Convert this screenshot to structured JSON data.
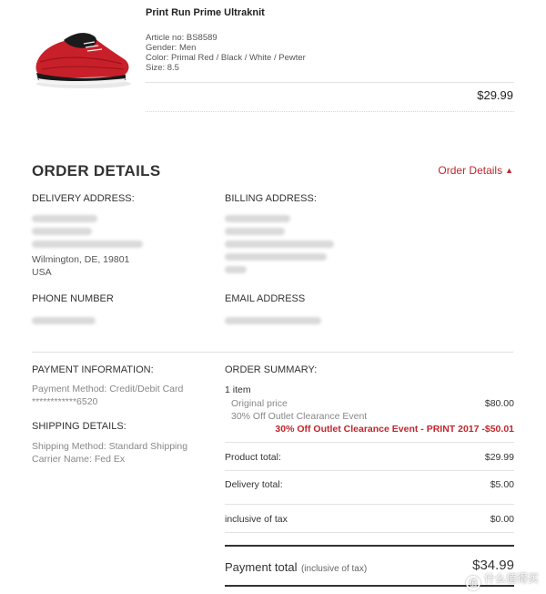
{
  "product": {
    "name": "Print Run Prime Ultraknit",
    "article": "Article no: BS8589",
    "gender": "Gender: Men",
    "color": "Color: Primal Red / Black / White / Pewter",
    "size": "Size: 8.5",
    "price": "$29.99",
    "image_icon": "running-shoe"
  },
  "order_details": {
    "title": "ORDER DETAILS",
    "toggle_label": "Order Details",
    "toggle_icon": "chevron-up",
    "accent_color": "#c0272d"
  },
  "delivery": {
    "label": "DELIVERY ADDRESS:",
    "city_line": "Wilmington, DE, 19801",
    "country": "USA"
  },
  "billing": {
    "label": "BILLING ADDRESS:"
  },
  "phone": {
    "label": "PHONE NUMBER"
  },
  "email": {
    "label": "EMAIL ADDRESS"
  },
  "payment": {
    "label": "PAYMENT INFORMATION:",
    "method": "Payment Method: Credit/Debit Card",
    "card": "************6520"
  },
  "shipping": {
    "label": "SHIPPING DETAILS:",
    "method": "Shipping Method: Standard Shipping",
    "carrier": "Carrier Name: Fed Ex"
  },
  "summary": {
    "label": "ORDER SUMMARY:",
    "items": "1 item",
    "original_price_label": "Original price",
    "original_price": "$80.00",
    "outlet_event": "30% Off Outlet Clearance Event",
    "promo": "30% Off Outlet Clearance Event - PRINT 2017 -$50.01",
    "product_total_label": "Product total:",
    "product_total": "$29.99",
    "delivery_total_label": "Delivery total:",
    "delivery_total": "$5.00",
    "tax_label": "inclusive of tax",
    "tax": "$0.00",
    "payment_total_label": "Payment total",
    "payment_total_sub": "(inclusive of tax)",
    "payment_total": "$34.99"
  },
  "watermark": {
    "text": "什么值得买",
    "icon": "zhi-logo-icon"
  }
}
